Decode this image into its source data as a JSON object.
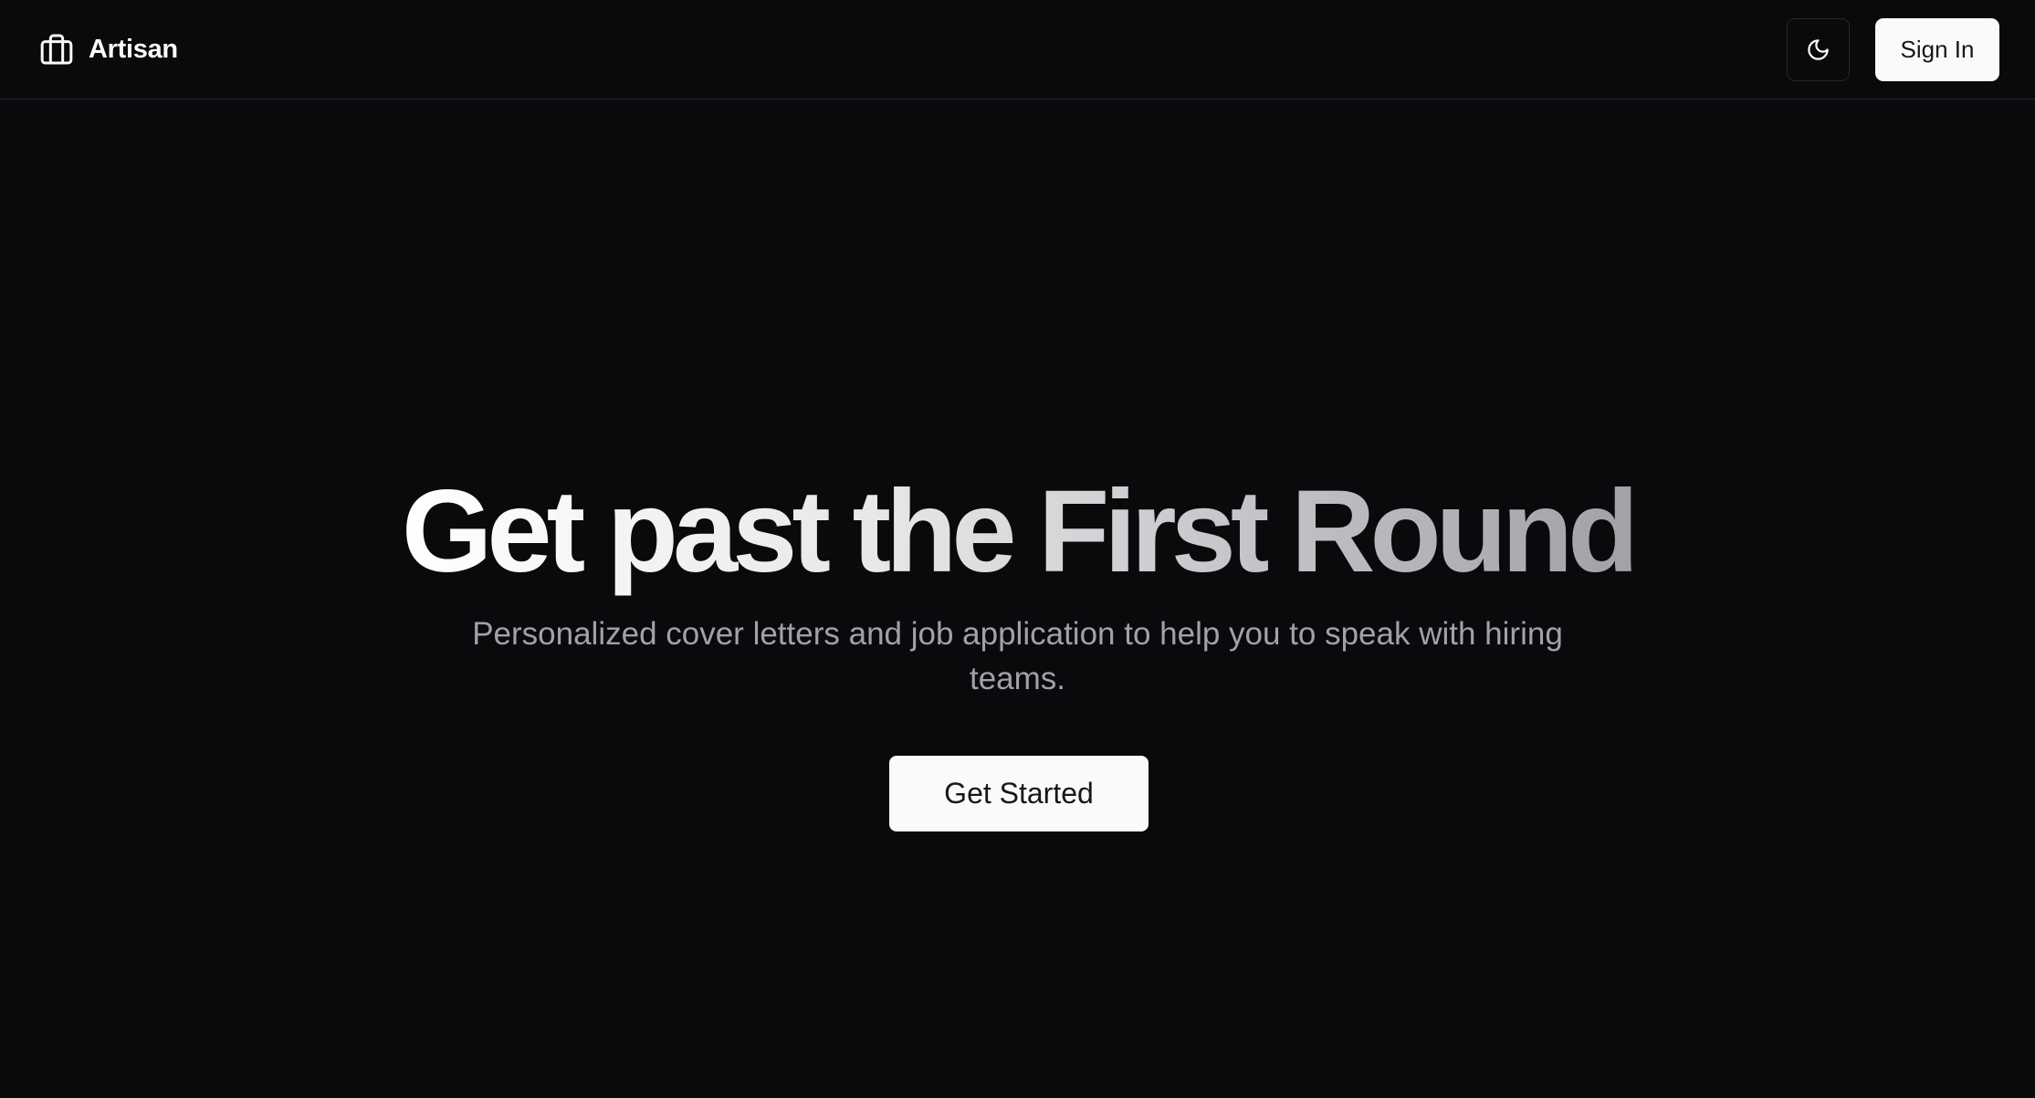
{
  "header": {
    "brand_icon": "briefcase-icon",
    "brand_name": "Artisan",
    "theme_toggle_icon": "moon-icon",
    "signin_label": "Sign In"
  },
  "hero": {
    "title": "Get past the First Round",
    "subtitle": "Personalized cover letters and job application to help you to speak with hiring teams.",
    "cta_label": "Get Started"
  },
  "colors": {
    "background": "#0a0a0c",
    "foreground": "#fafafa",
    "muted": "#a1a1aa",
    "button_bg": "#fafafa",
    "button_text": "#18181b",
    "border": "#26262b"
  }
}
